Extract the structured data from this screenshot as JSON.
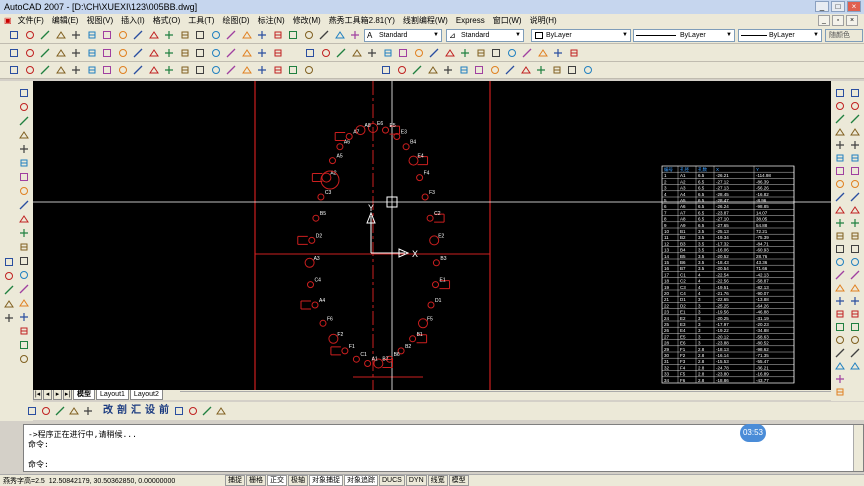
{
  "app": {
    "title": "AutoCAD 2007 - [D:\\CH\\XUEXI\\123\\005BB.dwg]"
  },
  "menu": {
    "items": [
      "文件(F)",
      "编辑(E)",
      "视图(V)",
      "插入(I)",
      "格式(O)",
      "工具(T)",
      "绘图(D)",
      "标注(N)",
      "修改(M)",
      "燕秀工具箱2.81(Y)",
      "线割编程(W)",
      "Express",
      "窗口(W)",
      "说明(H)"
    ]
  },
  "toolbar": {
    "text_style": "Standard",
    "dim_style": "Standard",
    "layer": "ByLayer",
    "color": "ByLayer",
    "linetype": "ByLayer",
    "lineweight": "ByLayer",
    "plotstyle": "随颜色"
  },
  "icons": {
    "std": [
      "new-icon",
      "open-icon",
      "save-icon",
      "print-icon",
      "preview-icon",
      "publish-icon",
      "cut-icon",
      "copy-icon",
      "paste-icon",
      "matchprop-icon",
      "undo-icon",
      "redo-icon",
      "pan-icon",
      "zoom-realtime-icon",
      "zoom-window-icon",
      "zoom-previous-icon",
      "properties-icon",
      "designcenter-icon",
      "toolpalette-icon",
      "sheetset-icon",
      "markup-icon",
      "calculator-icon",
      "help-icon"
    ],
    "row2": [
      "dim-linear-icon",
      "dim-aligned-icon",
      "dim-arc-icon",
      "dim-ordinate-icon",
      "dim-radius-icon",
      "dim-jogged-icon",
      "dim-diameter-icon",
      "dim-angular-icon",
      "quick-dim-icon",
      "baseline-icon",
      "continue-icon",
      "leader-icon",
      "tolerance-icon",
      "center-mark-icon",
      "dim-edit-icon",
      "dim-text-edit-icon",
      "dim-update-icon",
      "dim-style-icon"
    ],
    "row3": [
      "plus-icon",
      "tee-icon",
      "arrow-icon",
      "slot-icon",
      "wave-icon",
      "cross-icon",
      "box-icon",
      "triangle-icon",
      "line-icon",
      "angle-icon",
      "bolt-icon",
      "clip-icon",
      "bracket-icon",
      "star-icon",
      "hole-icon",
      "key-icon",
      "screw-icon",
      "ring-icon",
      "grid-icon",
      "check-icon"
    ],
    "left": [
      "point-icon",
      "line-icon",
      "xline-icon",
      "polyline-icon",
      "polygon-icon",
      "rectangle-icon",
      "arc-icon",
      "circle-icon",
      "revcloud-icon",
      "spline-icon",
      "ellipse-icon",
      "ellipse-arc-icon",
      "insert-block-icon",
      "make-block-icon",
      "point-style-icon",
      "hatch-icon",
      "gradient-icon",
      "region-icon",
      "table-icon",
      "mtext-icon"
    ],
    "right": [
      "erase-icon",
      "copy-obj-icon",
      "mirror-icon",
      "offset-icon",
      "array-icon",
      "move-icon",
      "rotate-icon",
      "scale-icon",
      "stretch-icon",
      "trim-icon",
      "extend-icon",
      "break-point-icon",
      "break-icon",
      "join-icon",
      "chamfer-icon",
      "fillet-icon",
      "explode-icon",
      "dim-icon",
      "align-icon",
      "lengthen-icon",
      "measure-icon",
      "divide-icon",
      "text-icon",
      "hatch-edit-icon"
    ],
    "bottom": [
      "layer-icon",
      "layers-icon",
      "print-icon",
      "image-icon",
      "text-a-icon",
      "process-icon",
      "cut-icon",
      "merge-icon",
      "setup-icon",
      "front-icon",
      "layer-on-icon",
      "layer-off-icon",
      "freeze-icon"
    ]
  },
  "tabs": [
    "模型",
    "Layout1",
    "Layout2"
  ],
  "bottom_labels": [
    "改",
    "剖",
    "汇",
    "设",
    "前"
  ],
  "command": {
    "line1": "->程序正在进行中,请稍候...",
    "line2": "命令:",
    "line3": "命令:"
  },
  "timer": "03:53",
  "status": {
    "prefix": "燕秀字高=2.5",
    "coords": "12.50842179,  30.50362850,  0.00000000",
    "buttons": [
      "捕捉",
      "栅格",
      "正交",
      "极轴",
      "对象捕捉",
      "对象追踪",
      "DUCS",
      "DYN",
      "线宽",
      "模型"
    ]
  },
  "drawing": {
    "labels": [
      "E6",
      "E5",
      "E3",
      "B4",
      "E4",
      "F4",
      "F3",
      "C2",
      "E2",
      "B3",
      "E1",
      "D1",
      "F5",
      "B1",
      "B2",
      "B6",
      "B7",
      "A1",
      "C1",
      "F1",
      "F2",
      "F6",
      "A4",
      "C4",
      "A3",
      "D2",
      "B5",
      "C3",
      "A2",
      "A5",
      "A6",
      "A7",
      "A8"
    ],
    "ucs_x": "X",
    "ucs_y": "Y",
    "table_header": [
      "编号",
      "孔径",
      "孔数",
      "X",
      "Y"
    ],
    "table_rows": [
      [
        "1",
        "A1",
        "6.5",
        "-26.21",
        "-114.98"
      ],
      [
        "2",
        "A2",
        "6.5",
        "-27.12",
        "-86.39"
      ],
      [
        "3",
        "A3",
        "6.5",
        "-27.13",
        "-56.26"
      ],
      [
        "4",
        "A4",
        "6.5",
        "-28.45",
        "-16.82"
      ],
      [
        "5",
        "A5",
        "6.5",
        "-28.47",
        "-8.96"
      ],
      [
        "6",
        "A6",
        "6.5",
        "-26.24",
        "-98.85"
      ],
      [
        "7",
        "A7",
        "6.5",
        "-23.87",
        "14.07"
      ],
      [
        "8",
        "A8",
        "6.5",
        "-27.10",
        "38.05"
      ],
      [
        "9",
        "A9",
        "6.5",
        "-27.65",
        "54.88"
      ],
      [
        "10",
        "B1",
        "3.5",
        "-25.13",
        "72.21"
      ],
      [
        "11",
        "B2",
        "3.5",
        "-19.34",
        "-75.39"
      ],
      [
        "12",
        "B3",
        "3.5",
        "-17.32",
        "-84.71"
      ],
      [
        "13",
        "B4",
        "3.5",
        "-16.06",
        "-60.93"
      ],
      [
        "14",
        "B5",
        "3.5",
        "-20.52",
        "28.76"
      ],
      [
        "15",
        "B6",
        "3.5",
        "-18.43",
        "43.36"
      ],
      [
        "16",
        "B7",
        "3.5",
        "-20.54",
        "71.66"
      ],
      [
        "17",
        "C1",
        "4",
        "-22.54",
        "-42.13"
      ],
      [
        "18",
        "C2",
        "4",
        "-22.56",
        "-58.87"
      ],
      [
        "19",
        "C3",
        "4",
        "-19.51",
        "-82.13"
      ],
      [
        "20",
        "C4",
        "4",
        "-21.76",
        "-90.07"
      ],
      [
        "21",
        "D1",
        "3",
        "-22.65",
        "-13.88"
      ],
      [
        "22",
        "D2",
        "3",
        "-25.25",
        "-64.26"
      ],
      [
        "23",
        "E1",
        "3",
        "-19.56",
        "-46.88"
      ],
      [
        "24",
        "E2",
        "3",
        "-20.25",
        "-31.19"
      ],
      [
        "25",
        "E3",
        "3",
        "-17.97",
        "-20.23"
      ],
      [
        "26",
        "E4",
        "3",
        "-19.22",
        "-34.88"
      ],
      [
        "27",
        "E5",
        "3",
        "-20.12",
        "-58.63"
      ],
      [
        "28",
        "E6",
        "3",
        "-23.88",
        "-80.52"
      ],
      [
        "29",
        "F1",
        "2.8",
        "-18.13",
        "-98.62"
      ],
      [
        "30",
        "F2",
        "2.8",
        "-16.14",
        "-71.35"
      ],
      [
        "31",
        "F3",
        "2.8",
        "-15.53",
        "-55.47"
      ],
      [
        "32",
        "F4",
        "2.8",
        "-24.78",
        "-36.21"
      ],
      [
        "33",
        "F5",
        "2.8",
        "-23.80",
        "-16.89"
      ],
      [
        "34",
        "F6",
        "2.8",
        "-18.86",
        "-43.77"
      ]
    ]
  },
  "colors": {
    "canvas_bg": "#000000",
    "red_line": "#cc1f1f",
    "white": "#ffffff",
    "toolbar_bg": "#ece9d8",
    "title_bg": "#c6d6ee",
    "timer_bg": "#4a8cd8"
  }
}
